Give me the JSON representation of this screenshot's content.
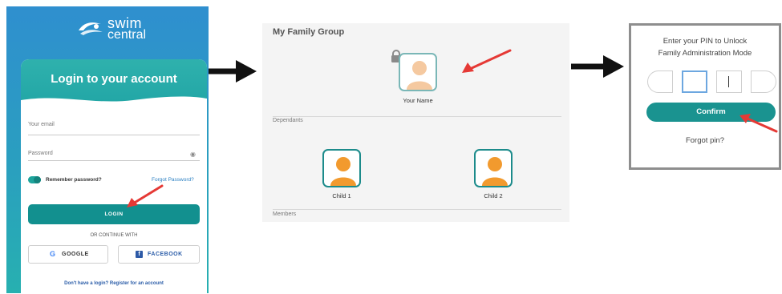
{
  "login": {
    "logo_word1": "swim",
    "logo_word2": "central",
    "title": "Login to your account",
    "email_label": "Your email",
    "password_label": "Password",
    "remember_label": "Remember password?",
    "forgot_label": "Forgot Password?",
    "login_button": "LOGIN",
    "or_continue": "OR CONTINUE WITH",
    "google_button": "GOOGLE",
    "facebook_button": "FACEBOOK",
    "register_link": "Don't have a login? Register for an account",
    "remember_checked": true
  },
  "family": {
    "title": "My Family Group",
    "main_member_name": "Your Name",
    "dependants_label": "Dependants",
    "members_label": "Members",
    "children": [
      {
        "name": "Child 1"
      },
      {
        "name": "Child 2"
      }
    ]
  },
  "pin_dialog": {
    "prompt_line1": "Enter your PIN to Unlock",
    "prompt_line2": "Family Administration Mode",
    "confirm_button": "Confirm",
    "forgot_pin": "Forgot pin?"
  },
  "colors": {
    "brand_teal": "#12908f",
    "panel_blue": "#2f8fcf",
    "annotation_red": "#e53935",
    "link_blue": "#2a5ca8",
    "avatar_orange": "#f29a2e",
    "avatar_peach": "#f5c9a0"
  },
  "icons": [
    "swim-central-logo-icon",
    "eye-icon",
    "google-icon",
    "facebook-icon",
    "lock-icon",
    "person-avatar-icon",
    "flow-arrow-icon",
    "annotation-arrow-icon"
  ]
}
